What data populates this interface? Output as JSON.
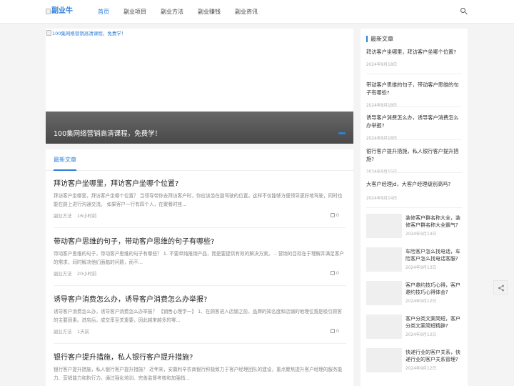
{
  "header": {
    "logo_text": "副业牛",
    "nav": [
      "首页",
      "副业项目",
      "副业方法",
      "副业赚钱",
      "副业资讯"
    ]
  },
  "banner": {
    "image_alt": "100集网络营销高清课程，免费学！",
    "caption": "100集网络营销高清课程，免费学！"
  },
  "main": {
    "tab_label": "最新文章",
    "posts": [
      {
        "title": "拜访客户坐哪里，拜访客户坐哪个位置?",
        "excerpt": "拜访客户坐哪里，拜访客户坐哪个位置？ 当领导带你去拜访客户时，你应该坐在副驾驶的位置。这样不仅能够方便领导更好地驾驶，同时也能在路上进行沟通交流。 如果客户一行有四个人，在聚餐时座...",
        "category": "副业方法",
        "time": "16小时前",
        "likes": "0"
      },
      {
        "title": "带动客户思维的句子，带动客户思维的句子有哪些?",
        "excerpt": "带动客户思维的句子，带动客户思维的句子有哪些？ 1. 不要单纯推销产品，而是要提供有效的解决方案。 – 营销的目标在于理解并满足客户的需求，同时解决他们面临的问题，而不...",
        "category": "副业方法",
        "time": "20小时前",
        "likes": "0"
      },
      {
        "title": "诱导客户消费怎么办，诱导客户消费怎么办举报?",
        "excerpt": "诱导客户消费怎么办，诱导客户消费怎么办举报？ 【销售心理学一】 1、在顾客进入店铺之前，品牌的知名度和店铺的地理位置是吸引顾客的主要因素。进店后，成交率至关重要，因此越来越多的零...",
        "category": "副业方法",
        "time": "1天前",
        "likes": "0"
      },
      {
        "title": "银行客户提升措施，私人银行客户提升措施?",
        "excerpt": "银行客户提升措施，私人银行客户提升措施？ 近年来，安徽利辛农商银行积极致力于客户经理团队的建设，重点聚焦提升客户经理的服务能力、营销能力和执行力。通过强化培训、完善监督考核和加强指...",
        "category": "",
        "time": "",
        "likes": ""
      }
    ]
  },
  "sidebar": {
    "heading": "最新文章",
    "articles": [
      {
        "title": "拜访客户坐哪里，拜访客户坐哪个位置?",
        "date": "2024年9月18日"
      },
      {
        "title": "带动客户思维的句子，带动客户思维的句子有哪些?",
        "date": "2024年9月18日"
      },
      {
        "title": "诱导客户消费怎么办，诱导客户消费怎么办举报?",
        "date": "2024年9月18日"
      },
      {
        "title": "银行客户提升措施，私人银行客户提升措施?",
        "date": "2024年9月15日"
      },
      {
        "title": "大客户经理jd，大客户经理级别高吗?",
        "date": "2024年9月14日"
      }
    ],
    "thumb_articles": [
      {
        "title": "装修客户群名称大全，装修客户群名称大全霸气?",
        "date": "2024年9月14日"
      },
      {
        "title": "车险客户怎么找电话，车险客户怎么找电话客服?",
        "date": "2024年9月13日"
      },
      {
        "title": "客户邀约技巧心得，客户邀约技巧心得体会?",
        "date": "2024年9月12日"
      },
      {
        "title": "客户分类文案简短，客户分类文案简短精辟?",
        "date": "2024年9月12日"
      },
      {
        "title": "快递行业的客户关系，快递行业的客户关系管理?",
        "date": "2024年9月12日"
      }
    ]
  },
  "colors": {
    "accent": "#2f7fd6"
  },
  "icons": {
    "search": "search-icon",
    "share": "share-icon",
    "like": "thumbs-up-icon"
  }
}
